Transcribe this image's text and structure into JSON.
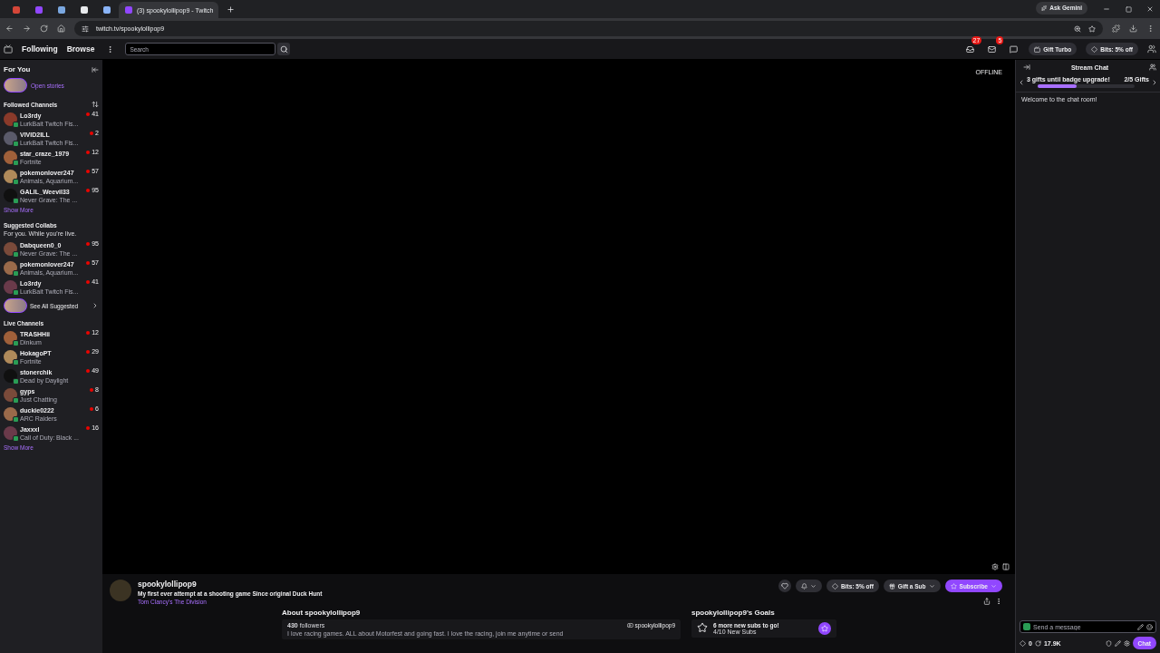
{
  "browser": {
    "tabs": [
      {
        "kind": "icon",
        "selected": false
      },
      {
        "kind": "icon",
        "selected": false
      },
      {
        "kind": "icon",
        "selected": false
      },
      {
        "kind": "icon",
        "selected": false
      },
      {
        "kind": "icon",
        "selected": false
      },
      {
        "kind": "page",
        "label": "(3) spookylollipop9 - Twitch",
        "selected": true
      }
    ],
    "ask": "Ask Gemini",
    "url": "twitch.tv/spookylollipop9"
  },
  "topnav": {
    "links": [
      "Following",
      "Browse"
    ],
    "search": {
      "placeholder": "Search"
    },
    "inbox_count": "27",
    "whispers_count": "5",
    "gift_turbo": "Gift Turbo",
    "bits": "Bits: 5% off"
  },
  "sidebar": {
    "title": "For You",
    "stories": "Open stories",
    "followed": {
      "title": "Followed Channels",
      "channels": [
        {
          "name": "Lo3rdy",
          "game": "LurkBait Twitch Fis...",
          "viewers": "41"
        },
        {
          "name": "VIVID2ILL",
          "game": "LurkBait Twitch Fis...",
          "viewers": "2"
        },
        {
          "name": "star_craze_1979",
          "game": "Fortnite",
          "viewers": "12"
        },
        {
          "name": "pokemonlover247",
          "game": "Animals, Aquarium...",
          "viewers": "57"
        },
        {
          "name": "GALIL_Weevil33",
          "game": "Never Grave: The ...",
          "viewers": "95"
        }
      ],
      "show_more": "Show More"
    },
    "suggested": {
      "title": "Suggested Collabs",
      "subtitle": "For you. While you're live.",
      "channels": [
        {
          "name": "Dabqueen0_0",
          "game": "Never Grave: The ...",
          "viewers": "95"
        },
        {
          "name": "pokemonlover247",
          "game": "Animals, Aquarium...",
          "viewers": "57"
        },
        {
          "name": "Lo3rdy",
          "game": "LurkBait Twitch Fis...",
          "viewers": "41"
        }
      ],
      "see_all": "See All Suggested"
    },
    "live": {
      "title": "Live Channels",
      "channels": [
        {
          "name": "TRASHHii",
          "game": "Dinkum",
          "viewers": "12"
        },
        {
          "name": "HokagoPT",
          "game": "Fortnite",
          "viewers": "29"
        },
        {
          "name": "stonerchik",
          "game": "Dead by Daylight",
          "viewers": "49"
        },
        {
          "name": "gyps",
          "game": "Just Chatting",
          "viewers": "8"
        },
        {
          "name": "duckie0222",
          "game": "ARC Raiders",
          "viewers": "6"
        },
        {
          "name": "Jaxxxl",
          "game": "Call of Duty: Black ...",
          "viewers": "16"
        }
      ],
      "show_more": "Show More"
    }
  },
  "player": {
    "status": "OFFLINE"
  },
  "channel": {
    "name": "spookylollipop9",
    "title": "My first ever attempt at a shooting game Since original Duck Hunt",
    "game": "Tom Clancy's The Division",
    "bits": "Bits: 5% off",
    "gift": "Gift a Sub",
    "subscribe": "Subscribe"
  },
  "about": {
    "title": "About spookylollipop9",
    "followers": "**430** followers",
    "bio": "I love racing games. ALL about Motorfest and going fast. I love the racing, join me anytime or send",
    "social": "spookylollipop9"
  },
  "goals": {
    "title": "spookylollipop9's Goals",
    "goal": "6 more new subs to go!",
    "progress": "4/10 New Subs"
  },
  "chat": {
    "title": "Stream Chat",
    "hype": {
      "text": "3 gifts until badge upgrade!",
      "count": "2/5 Gifts",
      "level": 0.4
    },
    "welcome": "Welcome to the chat room!",
    "input": {
      "placeholder": "Send a message"
    },
    "points": "0",
    "watch": "17.9K",
    "send": "Chat"
  }
}
